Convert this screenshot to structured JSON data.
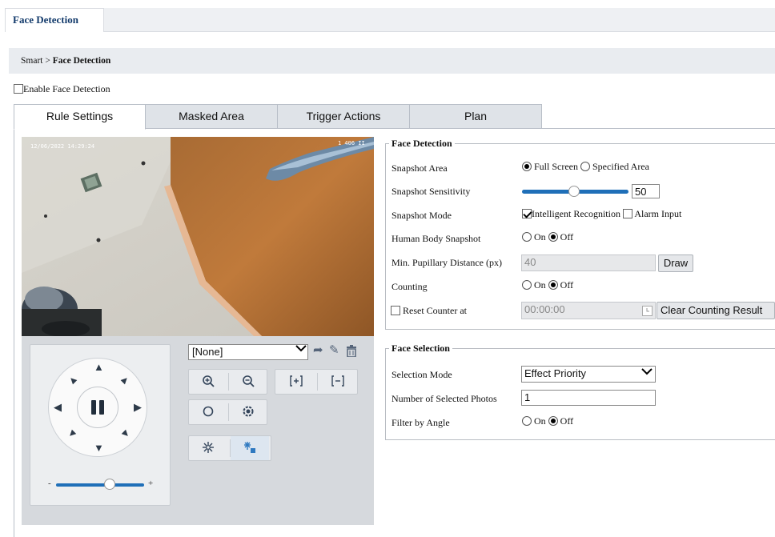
{
  "top_tab": "Face Detection",
  "breadcrumb": {
    "root": "Smart",
    "sep": ">",
    "current": "Face Detection"
  },
  "enable_label": "Enable Face Detection",
  "tabs": [
    "Rule Settings",
    "Masked Area",
    "Trigger Actions",
    "Plan"
  ],
  "video": {
    "osd_time": "12/06/2022 14:29:24",
    "osd_name": "1 406 II"
  },
  "ptz": {
    "preset_value": "[None]",
    "zoom_minus": "-",
    "zoom_plus": "+"
  },
  "face_detection": {
    "legend": "Face Detection",
    "snapshot_area_label": "Snapshot Area",
    "full_screen": "Full Screen",
    "specified_area": "Specified Area",
    "sensitivity_label": "Snapshot Sensitivity",
    "sensitivity_value": "50",
    "sensitivity_level": 0.5,
    "mode_label": "Snapshot Mode",
    "intelligent": "Intelligent Recognition",
    "alarm_input": "Alarm Input",
    "body_label": "Human Body Snapshot",
    "on": "On",
    "off": "Off",
    "pupil_label": "Min. Pupillary Distance (px)",
    "pupil_value": "40",
    "draw": "Draw",
    "counting_label": "Counting",
    "reset_label": "Reset Counter at",
    "reset_time": "00:00:00",
    "clear_btn": "Clear Counting Result"
  },
  "face_selection": {
    "legend": "Face Selection",
    "mode_label": "Selection Mode",
    "mode_value": "Effect Priority",
    "photos_label": "Number of Selected Photos",
    "photos_value": "1",
    "angle_label": "Filter by Angle",
    "on": "On",
    "off": "Off"
  },
  "colors": {
    "accent": "#1f6fb8",
    "title": "#123a6b",
    "panel": "#d6d9dd"
  }
}
